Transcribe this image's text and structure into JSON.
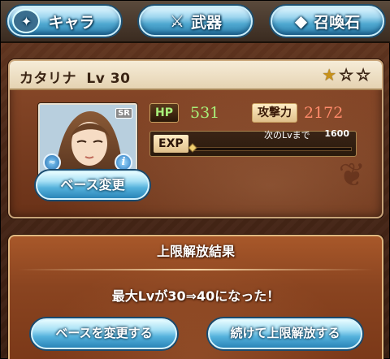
{
  "nav": {
    "chara_label": "キャラ",
    "weapon_label": "武器",
    "summon_label": "召喚石"
  },
  "character": {
    "name": "カタリナ",
    "level_text": "Lv 30",
    "rarity": "SR",
    "stars_total": 3,
    "stars_filled": 1,
    "hp_label": "HP",
    "hp": "531",
    "atk_label": "攻撃力",
    "atk": "2172",
    "exp_label": "EXP",
    "next_label": "次のLvまで",
    "next_exp": "1600",
    "exp_fraction": 0.0,
    "base_change_label": "ベース変更",
    "element_icon": "water-element-icon"
  },
  "dialog": {
    "title": "上限解放結果",
    "message": "最大Lvが30⇒40になった！",
    "btn_change_base": "ベースを変更する",
    "btn_continue": "続けて上限解放する"
  },
  "colors": {
    "accent_blue": "#55b2dc",
    "hp_green": "#a8f07a",
    "atk_red": "#ff8a6a",
    "panel_brown": "#8a4420"
  }
}
